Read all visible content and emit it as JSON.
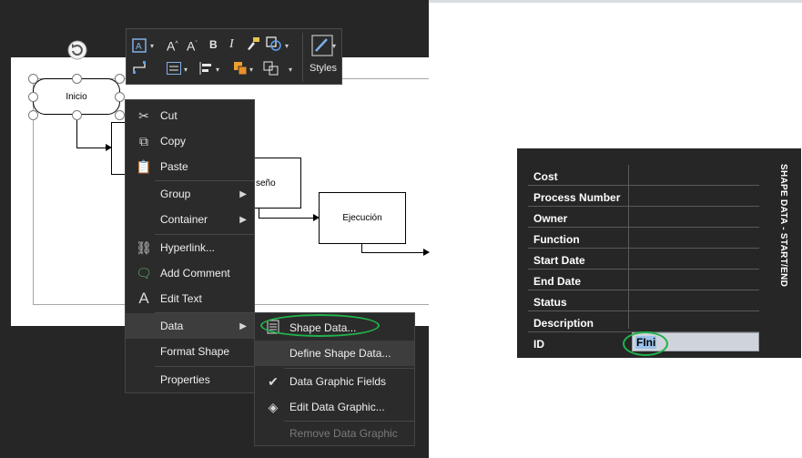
{
  "diagram": {
    "shapes": {
      "inicio": "Inicio",
      "diseno_partial": "seño",
      "ejecucion": "Ejecución"
    }
  },
  "toolbar": {
    "styles_label": "Styles",
    "icons": [
      "text-box-icon",
      "increase-font-icon",
      "decrease-font-icon",
      "bold-icon",
      "italic-icon",
      "format-painter-icon",
      "shape-icon",
      "connector-icon",
      "align-text-icon",
      "position-icon",
      "fill-color-icon",
      "line-color-icon",
      "styles-icon"
    ]
  },
  "context_menu": {
    "items": [
      {
        "label": "Cut",
        "icon": "scissors-icon"
      },
      {
        "label": "Copy",
        "icon": "copy-icon"
      },
      {
        "label": "Paste",
        "icon": "paste-icon"
      },
      {
        "label": "Group",
        "icon": "",
        "submenu": true
      },
      {
        "label": "Container",
        "icon": "",
        "submenu": true
      },
      {
        "label": "Hyperlink...",
        "icon": "link-icon"
      },
      {
        "label": "Add Comment",
        "icon": "comment-icon"
      },
      {
        "label": "Edit Text",
        "icon": "text-icon"
      },
      {
        "label": "Data",
        "icon": "",
        "submenu": true,
        "highlighted": true
      },
      {
        "label": "Format Shape",
        "icon": ""
      },
      {
        "label": "Properties",
        "icon": ""
      }
    ]
  },
  "data_submenu": {
    "items": [
      {
        "label": "Shape Data...",
        "icon": "shape-data-icon"
      },
      {
        "label": "Define Shape Data...",
        "icon": "",
        "highlighted": true
      },
      {
        "label": "Data Graphic Fields",
        "icon": "checkmark-icon",
        "checked": true
      },
      {
        "label": "Edit Data Graphic...",
        "icon": "data-graphic-icon"
      },
      {
        "label": "Remove Data Graphic",
        "icon": "",
        "disabled": true
      }
    ]
  },
  "shape_data_panel": {
    "title": "SHAPE DATA - START/END",
    "fields": [
      "Cost",
      "Process Number",
      "Owner",
      "Function",
      "Start Date",
      "End Date",
      "Status",
      "Description",
      "ID"
    ],
    "id_value": "FIni"
  },
  "colors": {
    "highlight_ellipse": "#22b14c",
    "dark_bg": "#262626",
    "menu_bg": "#2b2b2b",
    "selection": "#9cc1ea"
  }
}
